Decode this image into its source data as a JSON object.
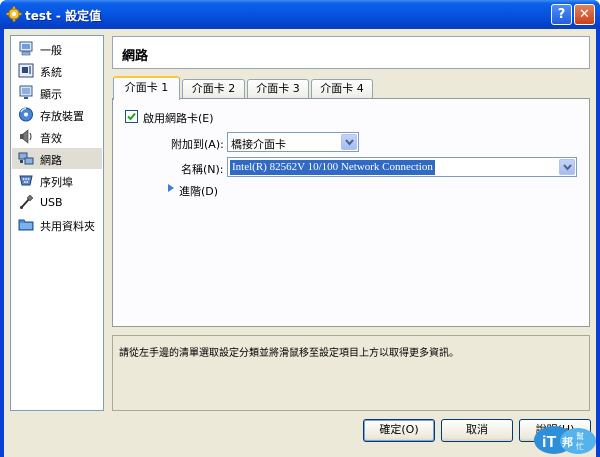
{
  "window": {
    "title": "test - 設定值",
    "help_label": "?",
    "close_label": "✕"
  },
  "sidebar": {
    "items": [
      {
        "label": "一般",
        "icon": "computer-icon"
      },
      {
        "label": "系統",
        "icon": "motherboard-icon"
      },
      {
        "label": "顯示",
        "icon": "monitor-icon"
      },
      {
        "label": "存放裝置",
        "icon": "disk-icon"
      },
      {
        "label": "音效",
        "icon": "speaker-icon"
      },
      {
        "label": "網路",
        "icon": "network-icon",
        "selected": true
      },
      {
        "label": "序列埠",
        "icon": "serial-port-icon"
      },
      {
        "label": "USB",
        "icon": "usb-icon"
      },
      {
        "label": "共用資料夾",
        "icon": "folder-icon"
      }
    ]
  },
  "header": {
    "title": "網路"
  },
  "tabs": [
    {
      "label": "介面卡 1",
      "active": true
    },
    {
      "label": "介面卡 2"
    },
    {
      "label": "介面卡 3"
    },
    {
      "label": "介面卡 4"
    }
  ],
  "panel": {
    "enable_label": "啟用網路卡(E)",
    "enable_checked": true,
    "attached_label": "附加到(A):",
    "attached_value": "橋接介面卡",
    "name_label": "名稱(N):",
    "name_value": "Intel(R) 82562V 10/100 Network Connection",
    "advanced_label": "進階(D)"
  },
  "info": {
    "text": "請從左手邊的清單選取設定分類並將滑鼠移至設定項目上方以取得更多資訊。"
  },
  "buttons": {
    "ok": "確定(O)",
    "cancel": "取消",
    "help": "說明(H)"
  },
  "watermark": {
    "text": "iT邦幫忙"
  },
  "colors": {
    "titlebar": "#0654e0",
    "selection": "#316ac5",
    "tab_accent": "#ffc83c"
  }
}
